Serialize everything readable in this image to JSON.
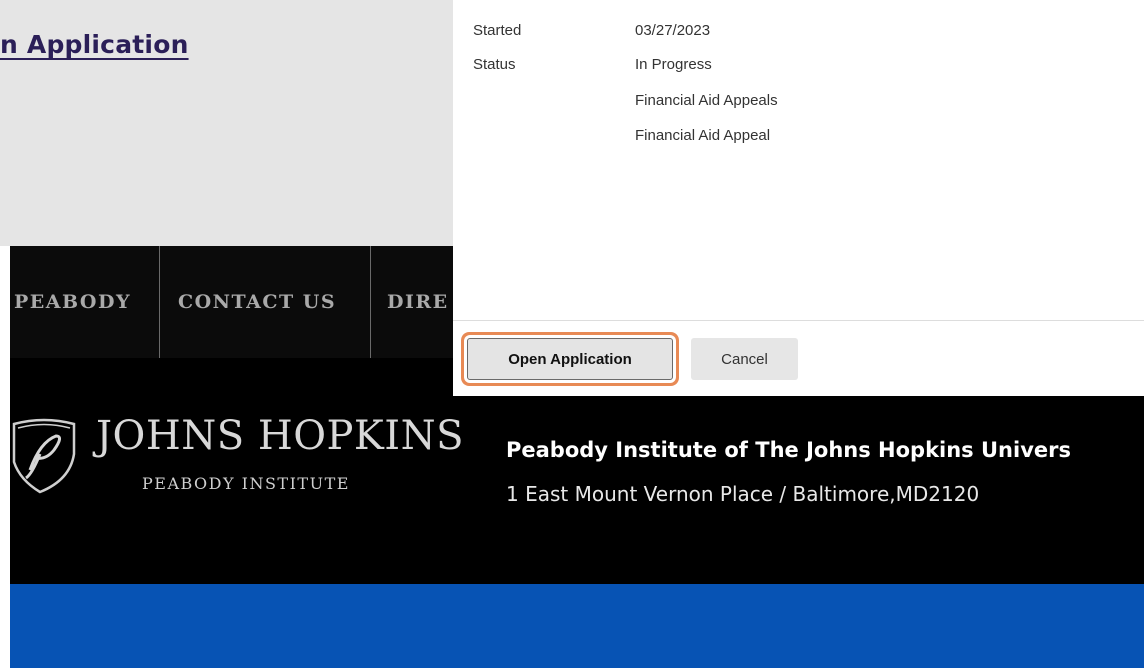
{
  "page": {
    "heading": "n Application"
  },
  "nav": {
    "items": [
      "PEABODY",
      "CONTACT US",
      "DIRE"
    ]
  },
  "dialog": {
    "fields": [
      {
        "label": "Started",
        "value": "03/27/2023"
      },
      {
        "label": "Status",
        "value": "In Progress"
      },
      {
        "label": "",
        "value": "Financial Aid Appeals"
      },
      {
        "label": "",
        "value": "Financial Aid Appeal"
      }
    ],
    "open_label": "Open Application",
    "cancel_label": "Cancel"
  },
  "footer": {
    "logo_title": "JOHNS HOPKINS",
    "logo_subtitle": "PEABODY INSTITUTE",
    "institute_name": "Peabody Institute of The Johns Hopkins Univers",
    "address": "1 East Mount Vernon Place  /  Baltimore,MD2120",
    "crest_icon": "shield-crest-icon"
  },
  "colors": {
    "heading": "#2b1f58",
    "focus_ring": "#e88a55",
    "footer_bg": "#000000",
    "blue_band": "#0753b4"
  }
}
